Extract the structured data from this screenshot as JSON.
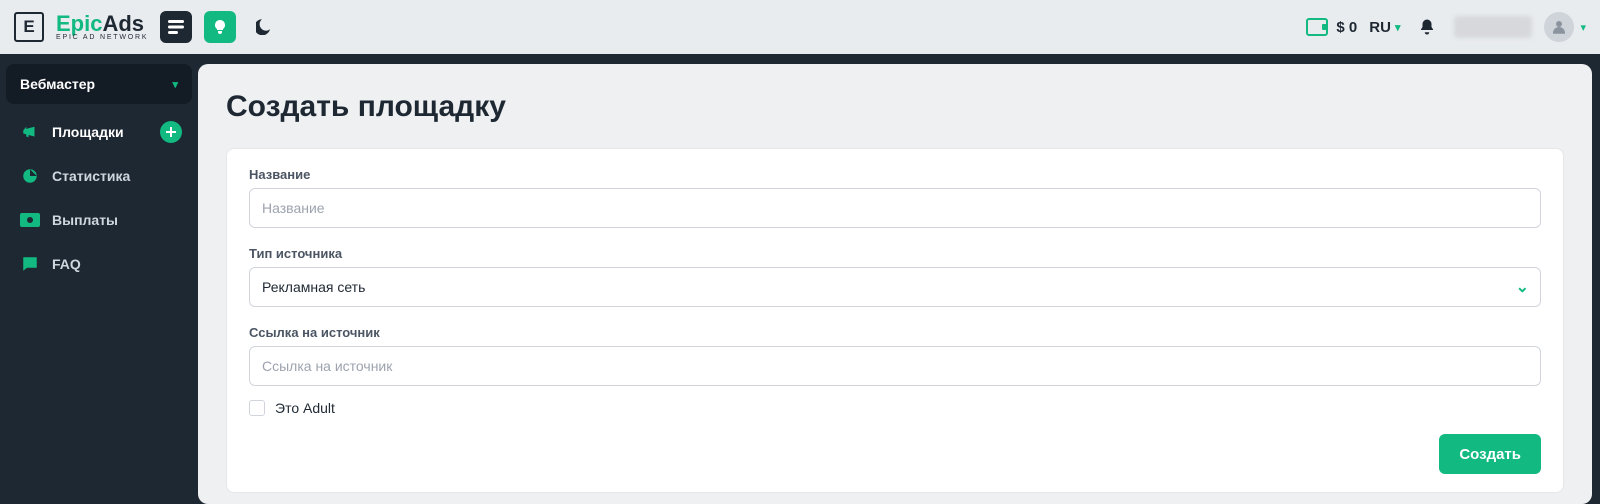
{
  "brand": {
    "name_a": "Epic",
    "name_b": "Ads",
    "tagline": "EPIC AD NETWORK",
    "mark": "E"
  },
  "header": {
    "balance_currency": "$",
    "balance_value": "0",
    "lang": "RU"
  },
  "sidebar": {
    "group_label": "Вебмастер",
    "items": [
      {
        "label": "Площадки"
      },
      {
        "label": "Статистика"
      },
      {
        "label": "Выплаты"
      },
      {
        "label": "FAQ"
      }
    ]
  },
  "page": {
    "title": "Создать площадку",
    "form": {
      "name_label": "Название",
      "name_placeholder": "Название",
      "source_type_label": "Тип источника",
      "source_type_value": "Рекламная сеть",
      "source_link_label": "Ссылка на источник",
      "source_link_placeholder": "Ссылка на источник",
      "adult_label": "Это Adult",
      "submit_label": "Создать"
    }
  }
}
